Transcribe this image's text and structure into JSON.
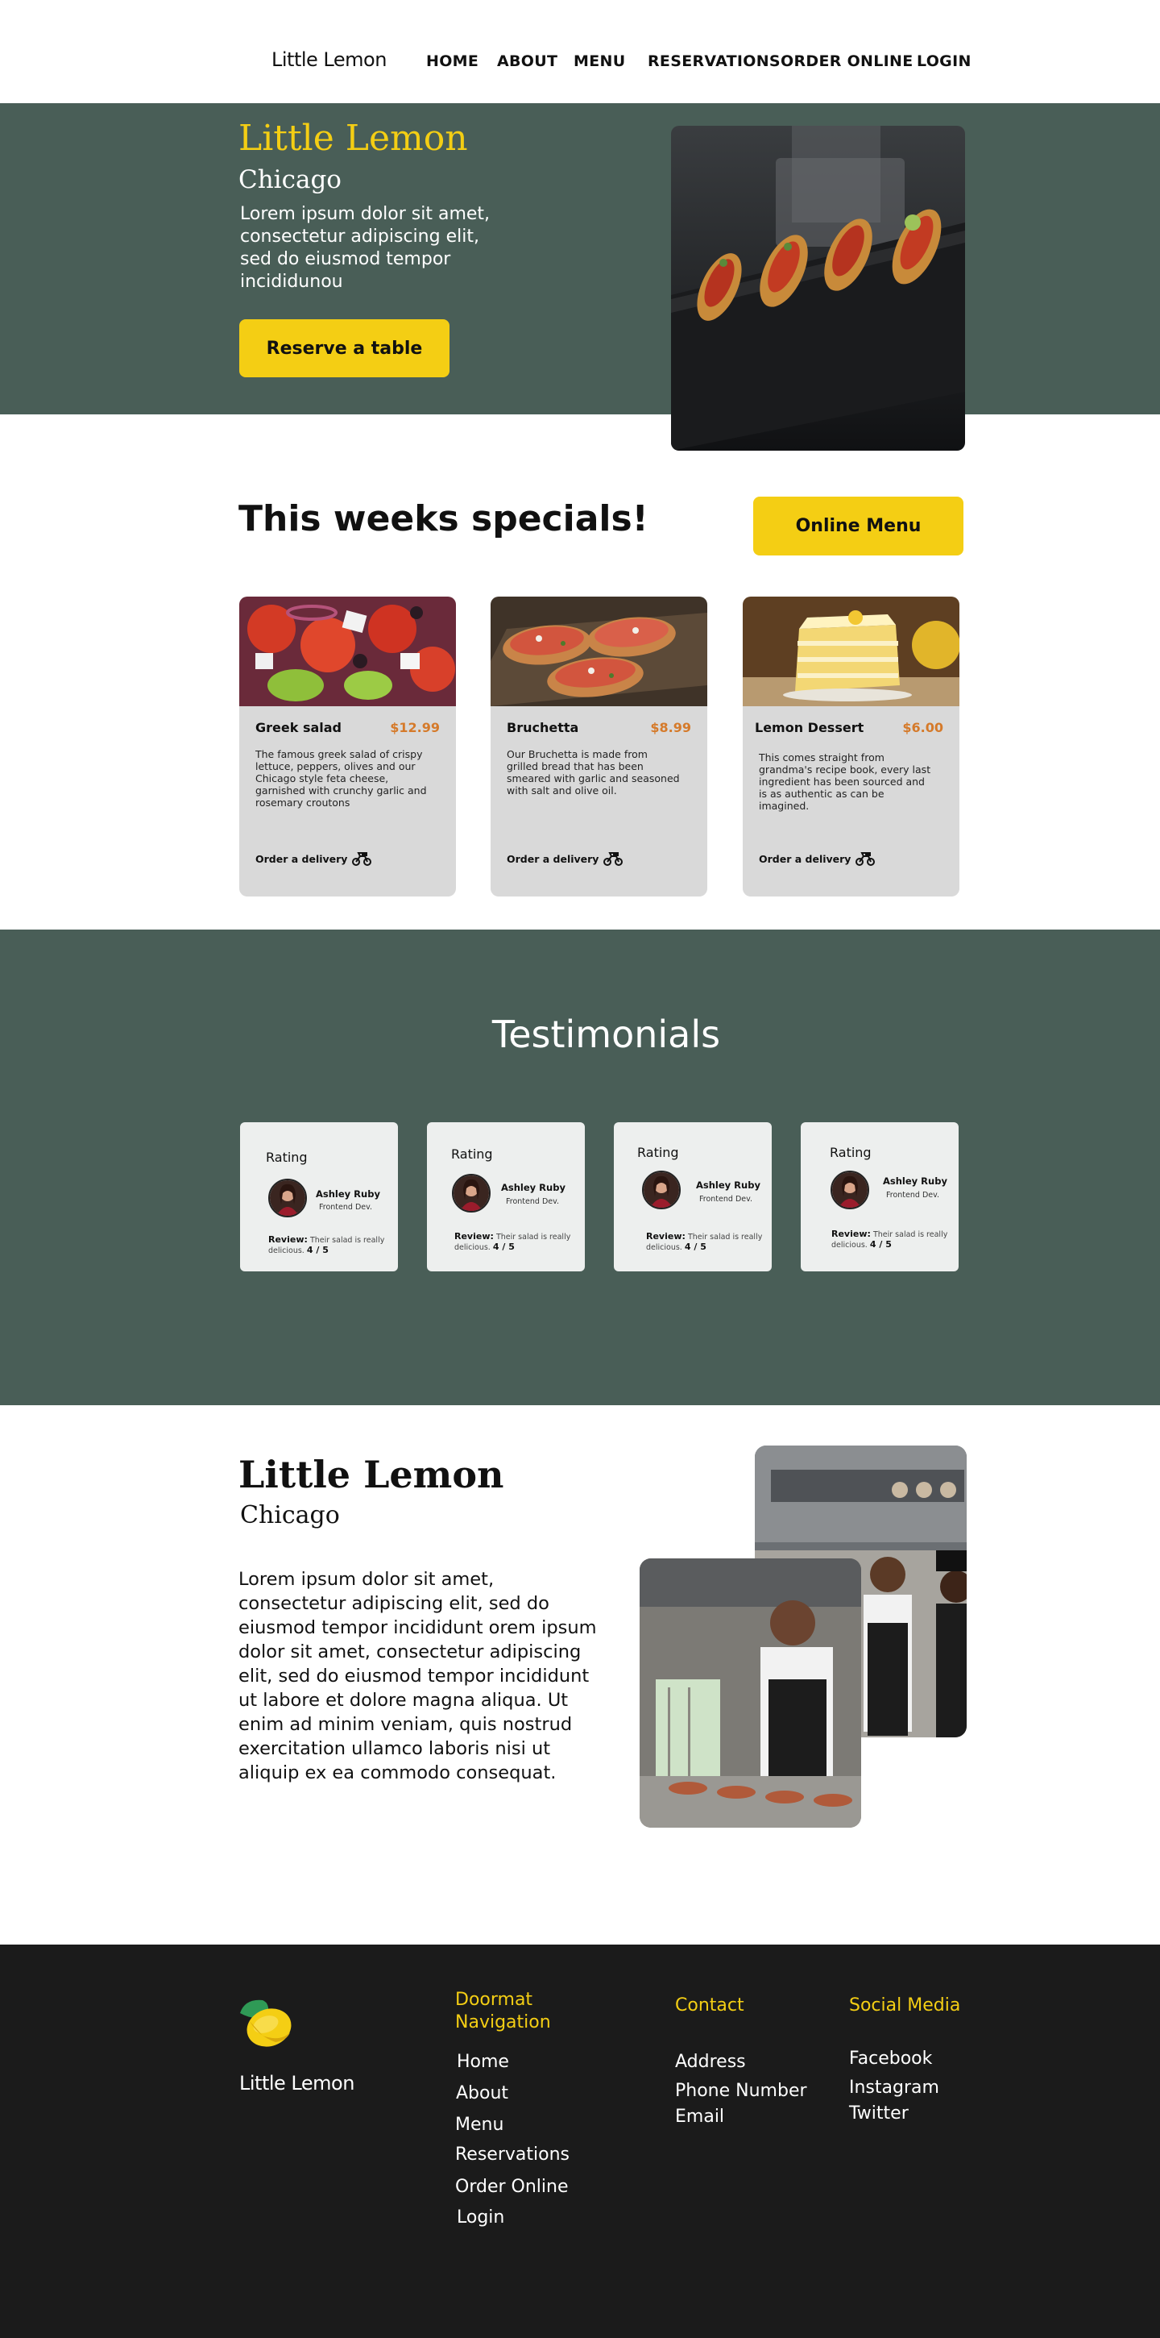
{
  "nav": {
    "logo": "Little Lemon",
    "links": [
      "HOME",
      "ABOUT",
      "MENU",
      "RESERVATIONS",
      "ORDER ONLINE",
      "LOGIN"
    ]
  },
  "hero": {
    "title": "Little Lemon",
    "city": "Chicago",
    "description": "Lorem ipsum dolor sit amet, consectetur adipiscing elit, sed do eiusmod tempor incididunou",
    "button": "Reserve a table"
  },
  "specials": {
    "title": "This weeks specials!",
    "button": "Online Menu",
    "cards": [
      {
        "name": "Greek salad",
        "price": "$12.99",
        "description": "The famous greek salad of crispy lettuce, peppers, olives and our Chicago style feta cheese, garnished with crunchy garlic and rosemary croutons",
        "order": "Order a delivery",
        "icon": "delivery-bike-icon"
      },
      {
        "name": "Bruchetta",
        "price": "$8.99",
        "description": "Our Bruchetta is made from grilled bread that has been smeared with garlic and seasoned with salt and olive oil.",
        "order": "Order a delivery",
        "icon": "delivery-bike-icon"
      },
      {
        "name": "Lemon Dessert",
        "price": "$6.00",
        "description": "This comes straight from grandma's recipe book, every last ingredient has been sourced and is as authentic as can be imagined.",
        "order": "Order a delivery",
        "icon": "delivery-bike-icon"
      }
    ]
  },
  "testimonials": {
    "title": "Testimonials",
    "cards": [
      {
        "rating": "Rating",
        "name": "Ashley Ruby",
        "role": "Frontend Dev.",
        "review_label": "Review:",
        "review": "Their salad is really delicious.",
        "score": "4 / 5"
      },
      {
        "rating": "Rating",
        "name": "Ashley Ruby",
        "role": "Frontend Dev.",
        "review_label": "Review:",
        "review": "Their salad is really delicious.",
        "score": "4 / 5"
      },
      {
        "rating": "Rating",
        "name": "Ashley Ruby",
        "role": "Frontend Dev.",
        "review_label": "Review:",
        "review": "Their salad is really delicious.",
        "score": "4 / 5"
      },
      {
        "rating": "Rating",
        "name": "Ashley Ruby",
        "role": "Frontend Dev.",
        "review_label": "Review:",
        "review": "Their salad is really delicious.",
        "score": "4 / 5"
      }
    ]
  },
  "about": {
    "title": "Little Lemon",
    "city": "Chicago",
    "text": "Lorem ipsum dolor sit amet, consectetur adipiscing elit, sed do eiusmod tempor incididunt orem ipsum dolor sit amet, consectetur adipiscing elit, sed do eiusmod  tempor incididunt ut labore et dolore magna aliqua. Ut enim ad minim  veniam, quis nostrud exercitation ullamco laboris nisi ut aliquip ex ea  commodo consequat."
  },
  "footer": {
    "brand": "Little Lemon",
    "doormat_title": "Doormat Navigation",
    "doormat_links": [
      "Home",
      "About",
      "Menu",
      "Reservations",
      "Order Online",
      "Login"
    ],
    "contact_title": "Contact",
    "contact_items": [
      "Address",
      "Phone Number",
      "Email"
    ],
    "social_title": "Social Media",
    "social_links": [
      "Facebook",
      "Instagram",
      "Twitter"
    ]
  },
  "colors": {
    "primary_green": "#495e57",
    "primary_yellow": "#f4ce14",
    "price_orange": "#d57a2a",
    "card_gray": "#d9d9d9",
    "footer_dark": "#1b1b1b"
  }
}
